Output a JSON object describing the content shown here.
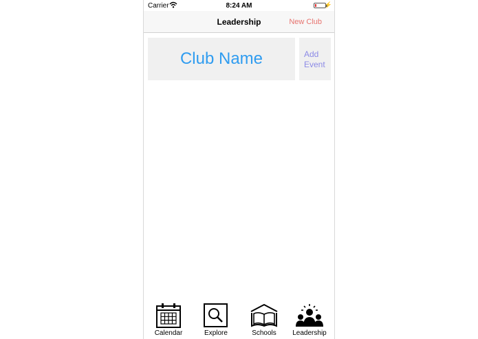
{
  "status_bar": {
    "carrier": "Carrier",
    "time": "8:24 AM",
    "battery_color": "#e03030",
    "battery_level": 0.1
  },
  "nav": {
    "title": "Leadership",
    "right_button": "New Club",
    "right_button_color": "#e7736f"
  },
  "club": {
    "name": "Club Name",
    "add_event_line1": "Add",
    "add_event_line2": "Event"
  },
  "tabs": [
    {
      "label": "Calendar",
      "icon": "calendar-icon"
    },
    {
      "label": "Explore",
      "icon": "magnifier-icon"
    },
    {
      "label": "Schools",
      "icon": "book-icon"
    },
    {
      "label": "Leadership",
      "icon": "people-icon"
    }
  ]
}
